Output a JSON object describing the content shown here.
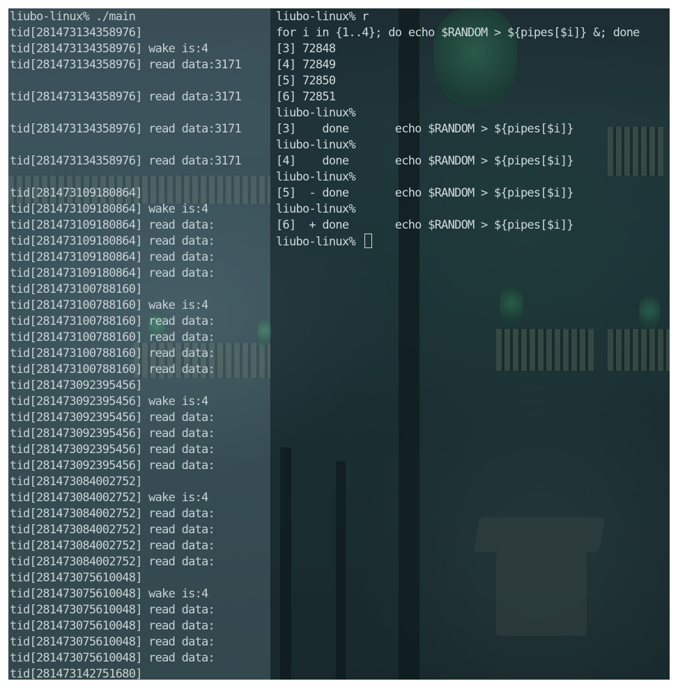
{
  "left_terminal": {
    "lines": [
      "liubo-linux% ./main",
      "tid[281473134358976]",
      "tid[281473134358976] wake is:4",
      "tid[281473134358976] read data:3171",
      "",
      "tid[281473134358976] read data:3171",
      "",
      "tid[281473134358976] read data:3171",
      "",
      "tid[281473134358976] read data:3171",
      "",
      "tid[281473109180864]",
      "tid[281473109180864] wake is:4",
      "tid[281473109180864] read data:",
      "tid[281473109180864] read data:",
      "tid[281473109180864] read data:",
      "tid[281473109180864] read data:",
      "tid[281473100788160]",
      "tid[281473100788160] wake is:4",
      "tid[281473100788160] read data:",
      "tid[281473100788160] read data:",
      "tid[281473100788160] read data:",
      "tid[281473100788160] read data:",
      "tid[281473092395456]",
      "tid[281473092395456] wake is:4",
      "tid[281473092395456] read data:",
      "tid[281473092395456] read data:",
      "tid[281473092395456] read data:",
      "tid[281473092395456] read data:",
      "tid[281473084002752]",
      "tid[281473084002752] wake is:4",
      "tid[281473084002752] read data:",
      "tid[281473084002752] read data:",
      "tid[281473084002752] read data:",
      "tid[281473084002752] read data:",
      "tid[281473075610048]",
      "tid[281473075610048] wake is:4",
      "tid[281473075610048] read data:",
      "tid[281473075610048] read data:",
      "tid[281473075610048] read data:",
      "tid[281473075610048] read data:",
      "tid[281473142751680]"
    ]
  },
  "right_terminal": {
    "lines": [
      "liubo-linux% r",
      "for i in {1..4}; do echo $RANDOM > ${pipes[$i]} &; done",
      "[3] 72848",
      "[4] 72849",
      "[5] 72850",
      "[6] 72851",
      "liubo-linux%",
      "[3]    done       echo $RANDOM > ${pipes[$i]}",
      "liubo-linux%",
      "[4]    done       echo $RANDOM > ${pipes[$i]}",
      "liubo-linux%",
      "[5]  - done       echo $RANDOM > ${pipes[$i]}",
      "liubo-linux%",
      "[6]  + done       echo $RANDOM > ${pipes[$i]}"
    ],
    "prompt": "liubo-linux% "
  }
}
